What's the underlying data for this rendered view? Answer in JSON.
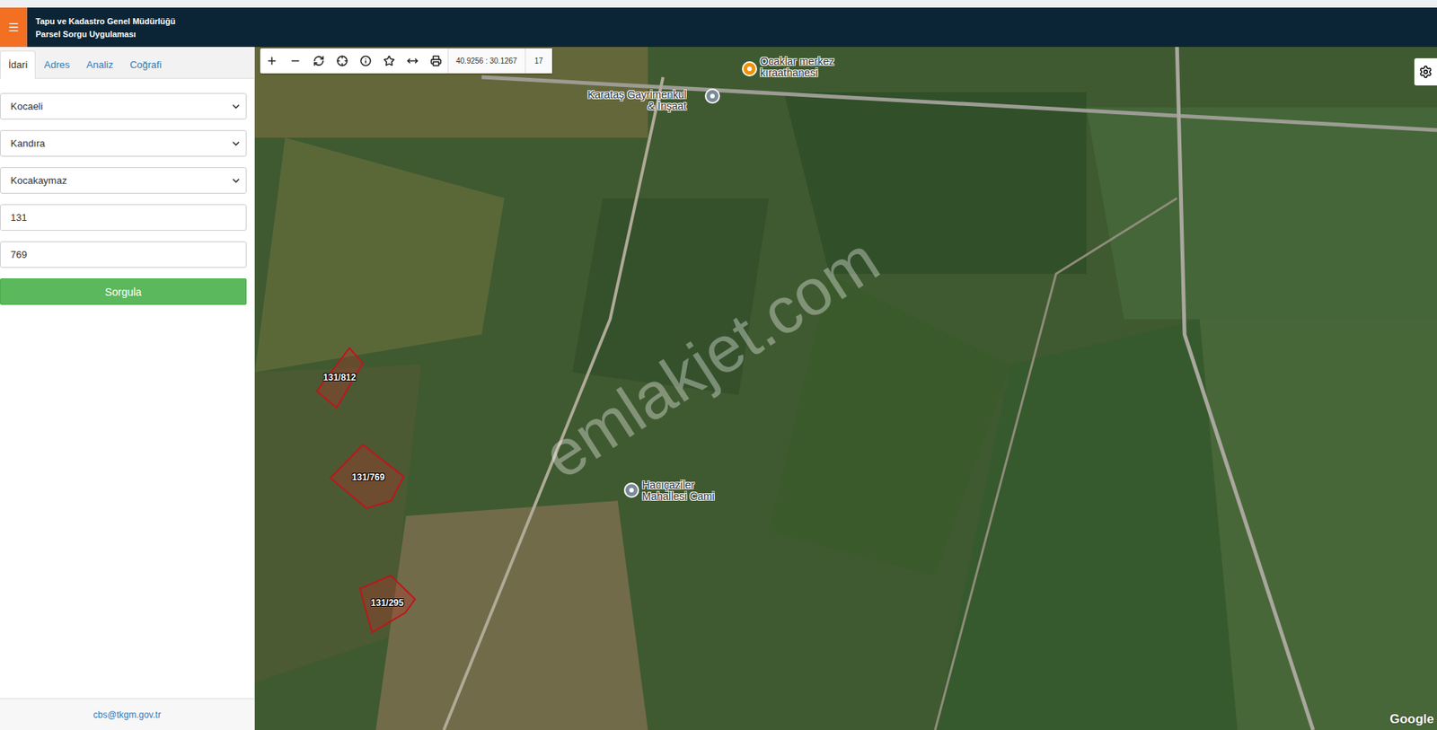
{
  "header": {
    "title_lines": [
      "Tapu ve Kadastro Genel Müdürlüğü",
      "Parsel Sorgu Uygulaması"
    ]
  },
  "tabs": [
    {
      "label": "İdari",
      "selected": true
    },
    {
      "label": "Adres",
      "selected": false
    },
    {
      "label": "Analiz",
      "selected": false
    },
    {
      "label": "Coğrafi",
      "selected": false
    }
  ],
  "form": {
    "fields": [
      {
        "kind": "select",
        "value": "Kocaeli"
      },
      {
        "kind": "select",
        "value": "Kandıra"
      },
      {
        "kind": "select",
        "value": "Kocakaymaz"
      },
      {
        "kind": "input",
        "value": "131"
      },
      {
        "kind": "input",
        "value": "769"
      }
    ],
    "submit": "Sorgula"
  },
  "footer": "cbs@tkgm.gov.tr",
  "map": {
    "toolbar": {
      "coordinates": "40.9256 : 30.1267",
      "zoom": "17"
    },
    "parcels": [
      {
        "label": "131/812"
      },
      {
        "label": "131/769"
      },
      {
        "label": "131/295"
      }
    ],
    "places": [
      {
        "kind": "cafe",
        "lines": [
          "Ocaklar merkez",
          "kıraathanesi"
        ]
      },
      {
        "kind": "place",
        "lines": [
          "Karataş Gayrimenkul",
          "& İnşaat"
        ]
      },
      {
        "kind": "place",
        "lines": [
          "Hacıçaziler",
          "Mahallesi Cami"
        ]
      }
    ],
    "watermark": "emlakjet.com",
    "attribution": "Google"
  }
}
